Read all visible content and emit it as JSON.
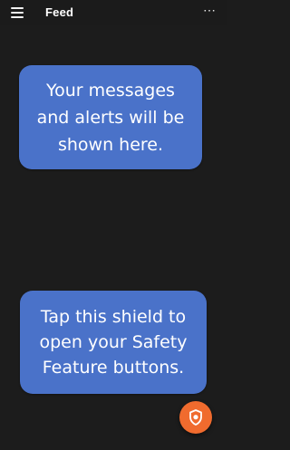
{
  "header": {
    "title": "Feed",
    "menu_icon": "hamburger-menu-icon",
    "more_icon": "more-options-icon",
    "more_glyph": "⋯"
  },
  "messages": [
    {
      "text": "Your messages\nand alerts will be\nshown here."
    },
    {
      "text": "Tap this shield to\nopen your Safety\nFeature buttons."
    }
  ],
  "fab": {
    "icon": "shield-icon",
    "color": "#f06b2e"
  },
  "colors": {
    "background": "#1c1c1c",
    "bubble": "#4a72c9"
  }
}
